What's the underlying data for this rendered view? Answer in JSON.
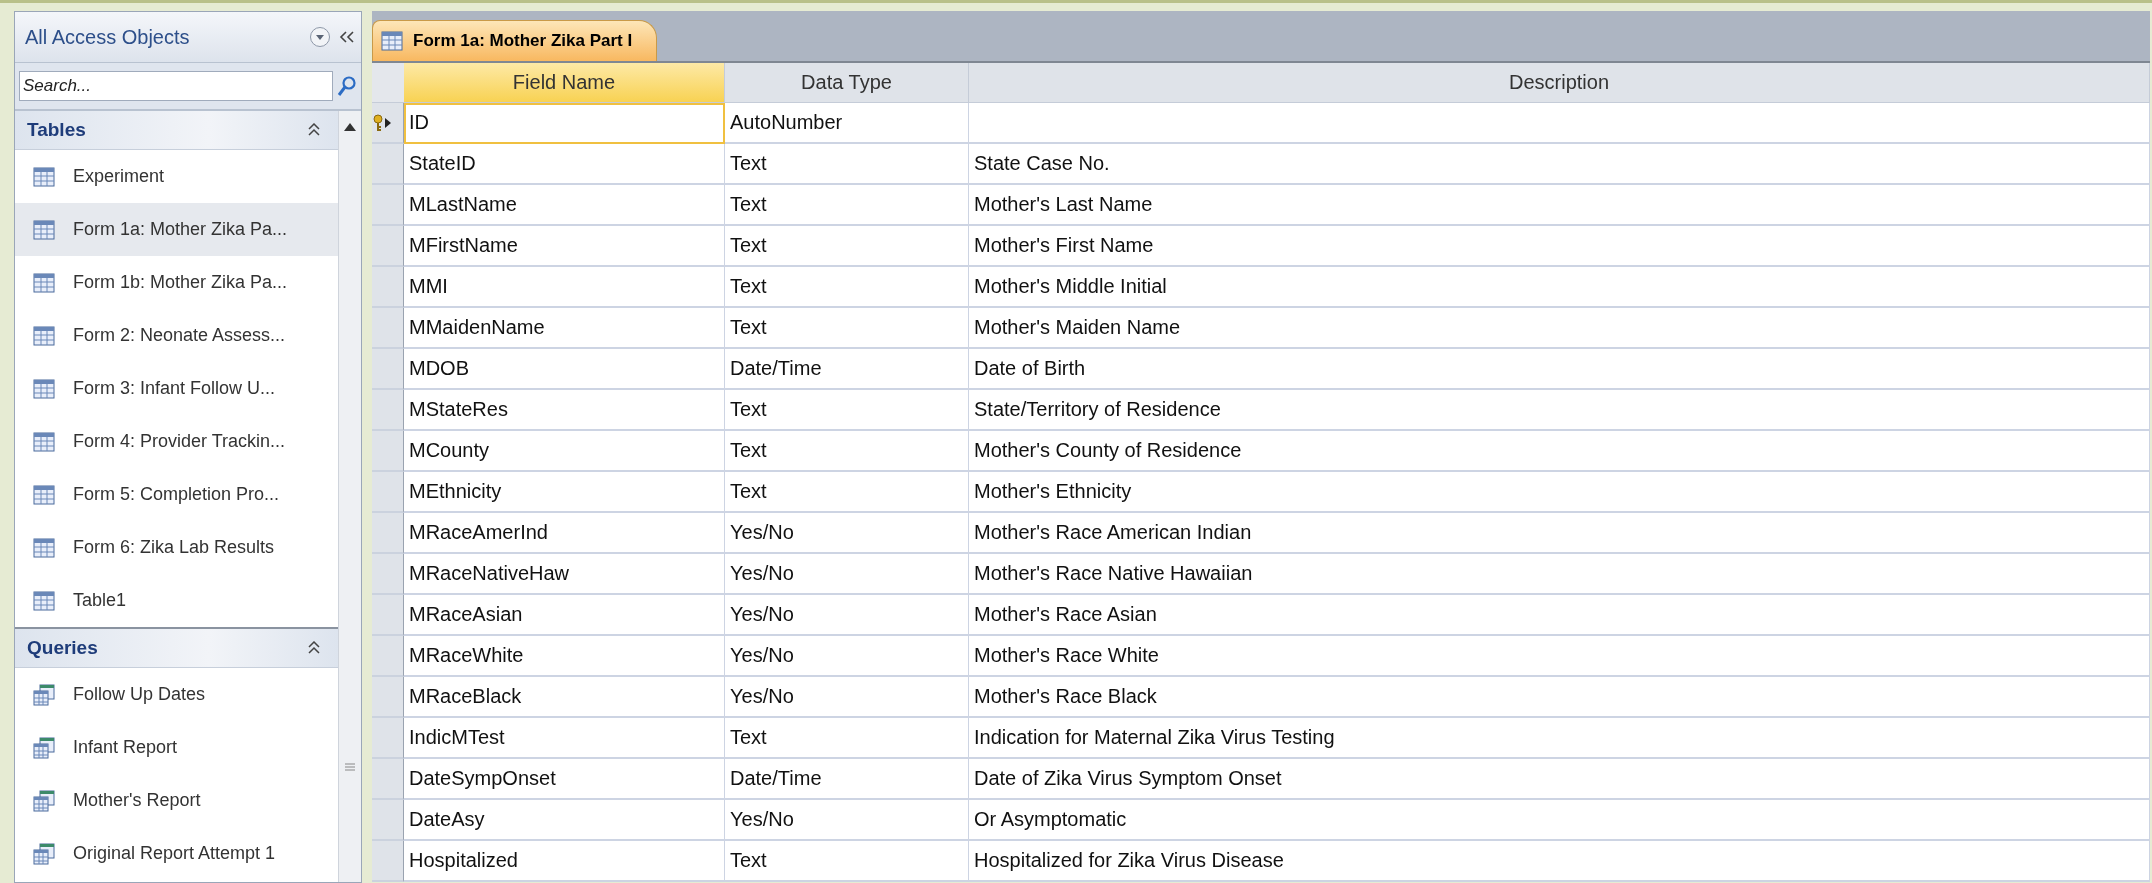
{
  "nav": {
    "title": "All Access Objects",
    "search": {
      "placeholder": "Search..."
    },
    "sections": [
      {
        "title": "Tables",
        "kind": "tables",
        "expanded": true,
        "items": [
          {
            "label": "Experiment",
            "selected": false
          },
          {
            "label": "Form 1a: Mother Zika Pa...",
            "selected": true
          },
          {
            "label": "Form 1b: Mother Zika Pa...",
            "selected": false
          },
          {
            "label": "Form 2: Neonate Assess...",
            "selected": false
          },
          {
            "label": "Form 3: Infant Follow U...",
            "selected": false
          },
          {
            "label": "Form 4: Provider Trackin...",
            "selected": false
          },
          {
            "label": "Form 5: Completion Pro...",
            "selected": false
          },
          {
            "label": "Form 6: Zika Lab Results",
            "selected": false
          },
          {
            "label": "Table1",
            "selected": false
          }
        ]
      },
      {
        "title": "Queries",
        "kind": "queries",
        "expanded": true,
        "items": [
          {
            "label": "Follow Up Dates",
            "selected": false
          },
          {
            "label": "Infant Report",
            "selected": false
          },
          {
            "label": "Mother's Report",
            "selected": false
          },
          {
            "label": "Original Report Attempt 1",
            "selected": false
          }
        ]
      }
    ]
  },
  "tabs": [
    {
      "label": "Form 1a: Mother Zika Part I",
      "selected": true
    }
  ],
  "table": {
    "columns": [
      "Field Name",
      "Data Type",
      "Description"
    ],
    "rows": [
      {
        "field": "ID",
        "type": "AutoNumber",
        "description": "",
        "primary_key": true,
        "selected": true
      },
      {
        "field": "StateID",
        "type": "Text",
        "description": "State Case No.",
        "primary_key": false,
        "selected": false
      },
      {
        "field": "MLastName",
        "type": "Text",
        "description": "Mother's Last Name",
        "primary_key": false,
        "selected": false
      },
      {
        "field": "MFirstName",
        "type": "Text",
        "description": "Mother's First Name",
        "primary_key": false,
        "selected": false
      },
      {
        "field": "MMI",
        "type": "Text",
        "description": "Mother's Middle Initial",
        "primary_key": false,
        "selected": false
      },
      {
        "field": "MMaidenName",
        "type": "Text",
        "description": "Mother's Maiden Name",
        "primary_key": false,
        "selected": false
      },
      {
        "field": "MDOB",
        "type": "Date/Time",
        "description": "Date of Birth",
        "primary_key": false,
        "selected": false
      },
      {
        "field": "MStateRes",
        "type": "Text",
        "description": "State/Territory of Residence",
        "primary_key": false,
        "selected": false
      },
      {
        "field": "MCounty",
        "type": "Text",
        "description": "Mother's County of Residence",
        "primary_key": false,
        "selected": false
      },
      {
        "field": "MEthnicity",
        "type": "Text",
        "description": "Mother's Ethnicity",
        "primary_key": false,
        "selected": false
      },
      {
        "field": "MRaceAmerInd",
        "type": "Yes/No",
        "description": "Mother's Race American Indian",
        "primary_key": false,
        "selected": false
      },
      {
        "field": "MRaceNativeHaw",
        "type": "Yes/No",
        "description": "Mother's Race Native Hawaiian",
        "primary_key": false,
        "selected": false
      },
      {
        "field": "MRaceAsian",
        "type": "Yes/No",
        "description": "Mother's Race Asian",
        "primary_key": false,
        "selected": false
      },
      {
        "field": "MRaceWhite",
        "type": "Yes/No",
        "description": "Mother's Race White",
        "primary_key": false,
        "selected": false
      },
      {
        "field": "MRaceBlack",
        "type": "Yes/No",
        "description": "Mother's Race Black",
        "primary_key": false,
        "selected": false
      },
      {
        "field": "IndicMTest",
        "type": "Text",
        "description": "Indication for Maternal Zika Virus Testing",
        "primary_key": false,
        "selected": false
      },
      {
        "field": "DateSympOnset",
        "type": "Date/Time",
        "description": "Date of Zika Virus Symptom Onset",
        "primary_key": false,
        "selected": false
      },
      {
        "field": "DateAsy",
        "type": "Yes/No",
        "description": "Or Asymptomatic",
        "primary_key": false,
        "selected": false
      },
      {
        "field": "Hospitalized",
        "type": "Text",
        "description": "Hospitalized for Zika Virus Disease",
        "primary_key": false,
        "selected": false
      }
    ]
  }
}
